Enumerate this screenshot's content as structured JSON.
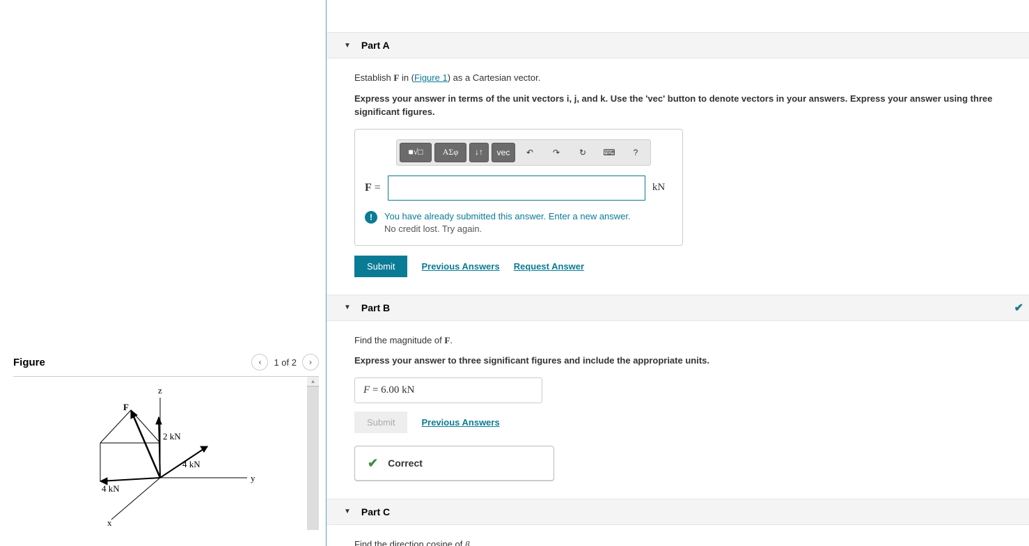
{
  "figure": {
    "title": "Figure",
    "page_label": "1 of 2",
    "axes": {
      "x": "x",
      "y": "y",
      "z": "z"
    },
    "vectors": {
      "F_label": "F",
      "v1": "2 kN",
      "v2": "4 kN",
      "v3": "4 kN"
    }
  },
  "partA": {
    "title": "Part A",
    "prompt_pre": "Establish ",
    "prompt_sym": "F",
    "prompt_mid": " in (",
    "figure_link": "Figure 1",
    "prompt_post": ") as a Cartesian vector.",
    "instruction_pre": "Express your answer in terms of the unit vectors ",
    "instruction_ij": "i, j,",
    "instruction_and": " and ",
    "instruction_k": "k.",
    "instruction_post": " Use the 'vec' button to denote vectors in your answers. Express your answer using three significant figures.",
    "toolbar": {
      "tmpl": "■√□",
      "greek": "ΑΣφ",
      "subsup": "↓↑",
      "vec": "vec",
      "undo": "↶",
      "redo": "↷",
      "reset": "↻",
      "keyboard": "⌨",
      "help": "?"
    },
    "input_label_sym": "F",
    "input_label_eq": " = ",
    "input_value": "",
    "unit": "kN",
    "feedback1": "You have already submitted this answer. Enter a new answer.",
    "feedback2": "No credit lost. Try again.",
    "submit": "Submit",
    "prev": "Previous Answers",
    "req": "Request Answer"
  },
  "partB": {
    "title": "Part B",
    "prompt_pre": "Find the magnitude of ",
    "prompt_sym": "F",
    "prompt_post": ".",
    "instruction": "Express your answer to three significant figures and include the appropriate units.",
    "answer_sym": "F",
    "answer_eq": " = ",
    "answer_val": "6.00 kN",
    "submit": "Submit",
    "prev": "Previous Answers",
    "correct": "Correct"
  },
  "partC": {
    "title": "Part C",
    "prompt_pre": "Find the direction cosine of ",
    "prompt_sym": "β",
    "prompt_post": "."
  }
}
